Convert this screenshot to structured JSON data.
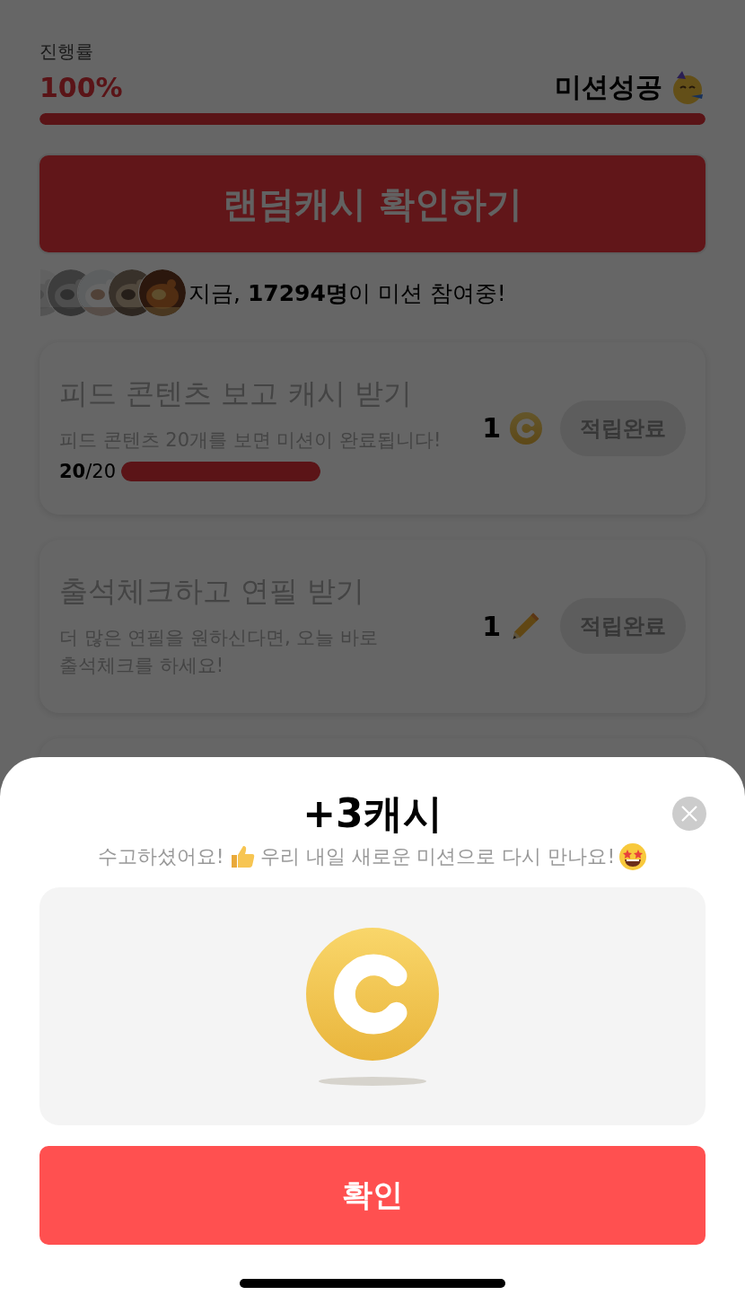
{
  "progress": {
    "label": "진행률",
    "percent": "100%",
    "level": 1,
    "status": "미션성공"
  },
  "random_cash_button": {
    "label": "랜덤캐시 확인하기"
  },
  "participants": {
    "text": "지금, **17294명**이 미션 참여중!"
  },
  "missions": [
    {
      "title": "피드 콘텐츠 보고 캐시 받기",
      "description": "피드 콘텐츠 20개를 보면 미션이 완료됩니다!",
      "reward": "1",
      "kind": "coin",
      "button": "적립완료",
      "progress": {
        "count": "**20**/20",
        "level": 1
      }
    },
    {
      "title": "출석체크하고 연필 받기",
      "description": "더 많은 연필을 원하신다면, 오늘 바로\n출석체크를 하세요!",
      "reward": "1",
      "kind": "pencil",
      "button": "적립완료"
    }
  ],
  "dialog": {
    "title": "+3캐시",
    "message_start": "수고하셨어요!",
    "message_end": "우리 내일 새로운 미션으로 다시 만나요!",
    "confirm": "확인"
  }
}
